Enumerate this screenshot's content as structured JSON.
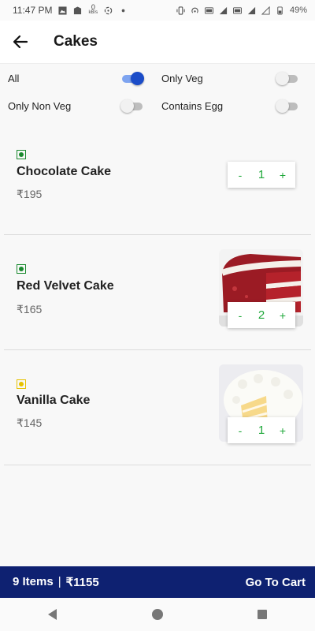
{
  "status": {
    "time": "11:47 PM",
    "speed_value": "0",
    "speed_unit": "kB/s",
    "battery": "49%"
  },
  "appbar": {
    "title": "Cakes",
    "back_icon": "arrow-left-icon"
  },
  "filters": [
    {
      "label": "All",
      "on": true
    },
    {
      "label": "Only Veg",
      "on": false
    },
    {
      "label": "Only Non Veg",
      "on": false
    },
    {
      "label": "Contains Egg",
      "on": false
    }
  ],
  "items": [
    {
      "name": "Chocolate Cake",
      "price": "₹195",
      "qty": "1",
      "mark": "veg",
      "image": null
    },
    {
      "name": "Red Velvet Cake",
      "price": "₹165",
      "qty": "2",
      "mark": "veg",
      "image": "red-velvet-cake-photo"
    },
    {
      "name": "Vanilla Cake",
      "price": "₹145",
      "qty": "1",
      "mark": "egg",
      "image": "vanilla-cake-photo"
    }
  ],
  "stepper": {
    "minus": "-",
    "plus": "+"
  },
  "cart": {
    "count": "9 Items",
    "separator": "|",
    "total": "₹1155",
    "go_label": "Go To Cart"
  },
  "colors": {
    "accent": "#1b4cc8",
    "cart_bar": "#0e2171",
    "stepper_green": "#1fa83a",
    "veg": "#1a8a2f",
    "egg": "#e6c200"
  }
}
